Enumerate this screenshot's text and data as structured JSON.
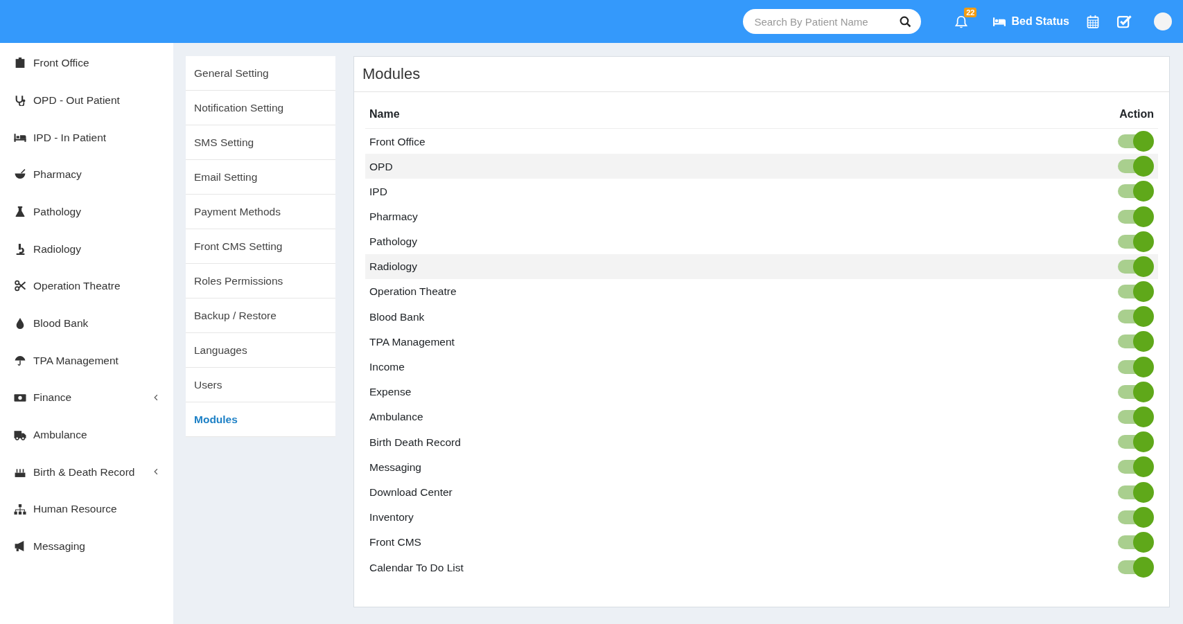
{
  "topbar": {
    "search": {
      "placeholder": "Search By Patient Name"
    },
    "notifications": {
      "count": "22"
    },
    "bed_status": "Bed Status"
  },
  "sidebar": {
    "items": [
      {
        "label": "Front Office",
        "expandable": false
      },
      {
        "label": "OPD - Out Patient",
        "expandable": false
      },
      {
        "label": "IPD - In Patient",
        "expandable": false
      },
      {
        "label": "Pharmacy",
        "expandable": false
      },
      {
        "label": "Pathology",
        "expandable": false
      },
      {
        "label": "Radiology",
        "expandable": false
      },
      {
        "label": "Operation Theatre",
        "expandable": false
      },
      {
        "label": "Blood Bank",
        "expandable": false
      },
      {
        "label": "TPA Management",
        "expandable": false
      },
      {
        "label": "Finance",
        "expandable": true
      },
      {
        "label": "Ambulance",
        "expandable": false
      },
      {
        "label": "Birth & Death Record",
        "expandable": true
      },
      {
        "label": "Human Resource",
        "expandable": false
      },
      {
        "label": "Messaging",
        "expandable": false
      }
    ]
  },
  "settings_menu": [
    {
      "label": "General Setting",
      "selected": false
    },
    {
      "label": "Notification Setting",
      "selected": false
    },
    {
      "label": "SMS Setting",
      "selected": false
    },
    {
      "label": "Email Setting",
      "selected": false
    },
    {
      "label": "Payment Methods",
      "selected": false
    },
    {
      "label": "Front CMS Setting",
      "selected": false
    },
    {
      "label": "Roles Permissions",
      "selected": false
    },
    {
      "label": "Backup / Restore",
      "selected": false
    },
    {
      "label": "Languages",
      "selected": false
    },
    {
      "label": "Users",
      "selected": false
    },
    {
      "label": "Modules",
      "selected": true
    }
  ],
  "modules": {
    "title": "Modules",
    "columns": [
      "Name",
      "Action"
    ],
    "rows": [
      {
        "name": "Front Office",
        "on": true,
        "highlighted": false
      },
      {
        "name": "OPD",
        "on": true,
        "highlighted": true
      },
      {
        "name": "IPD",
        "on": true,
        "highlighted": false
      },
      {
        "name": "Pharmacy",
        "on": true,
        "highlighted": false
      },
      {
        "name": "Pathology",
        "on": true,
        "highlighted": false
      },
      {
        "name": "Radiology",
        "on": true,
        "highlighted": true
      },
      {
        "name": "Operation Theatre",
        "on": true,
        "highlighted": false
      },
      {
        "name": "Blood Bank",
        "on": true,
        "highlighted": false
      },
      {
        "name": "TPA Management",
        "on": true,
        "highlighted": false
      },
      {
        "name": "Income",
        "on": true,
        "highlighted": false
      },
      {
        "name": "Expense",
        "on": true,
        "highlighted": false
      },
      {
        "name": "Ambulance",
        "on": true,
        "highlighted": false
      },
      {
        "name": "Birth Death Record",
        "on": true,
        "highlighted": false
      },
      {
        "name": "Messaging",
        "on": true,
        "highlighted": false
      },
      {
        "name": "Download Center",
        "on": true,
        "highlighted": false
      },
      {
        "name": "Inventory",
        "on": true,
        "highlighted": false
      },
      {
        "name": "Front CMS",
        "on": true,
        "highlighted": false
      },
      {
        "name": "Calendar To Do List",
        "on": true,
        "highlighted": false
      }
    ]
  }
}
